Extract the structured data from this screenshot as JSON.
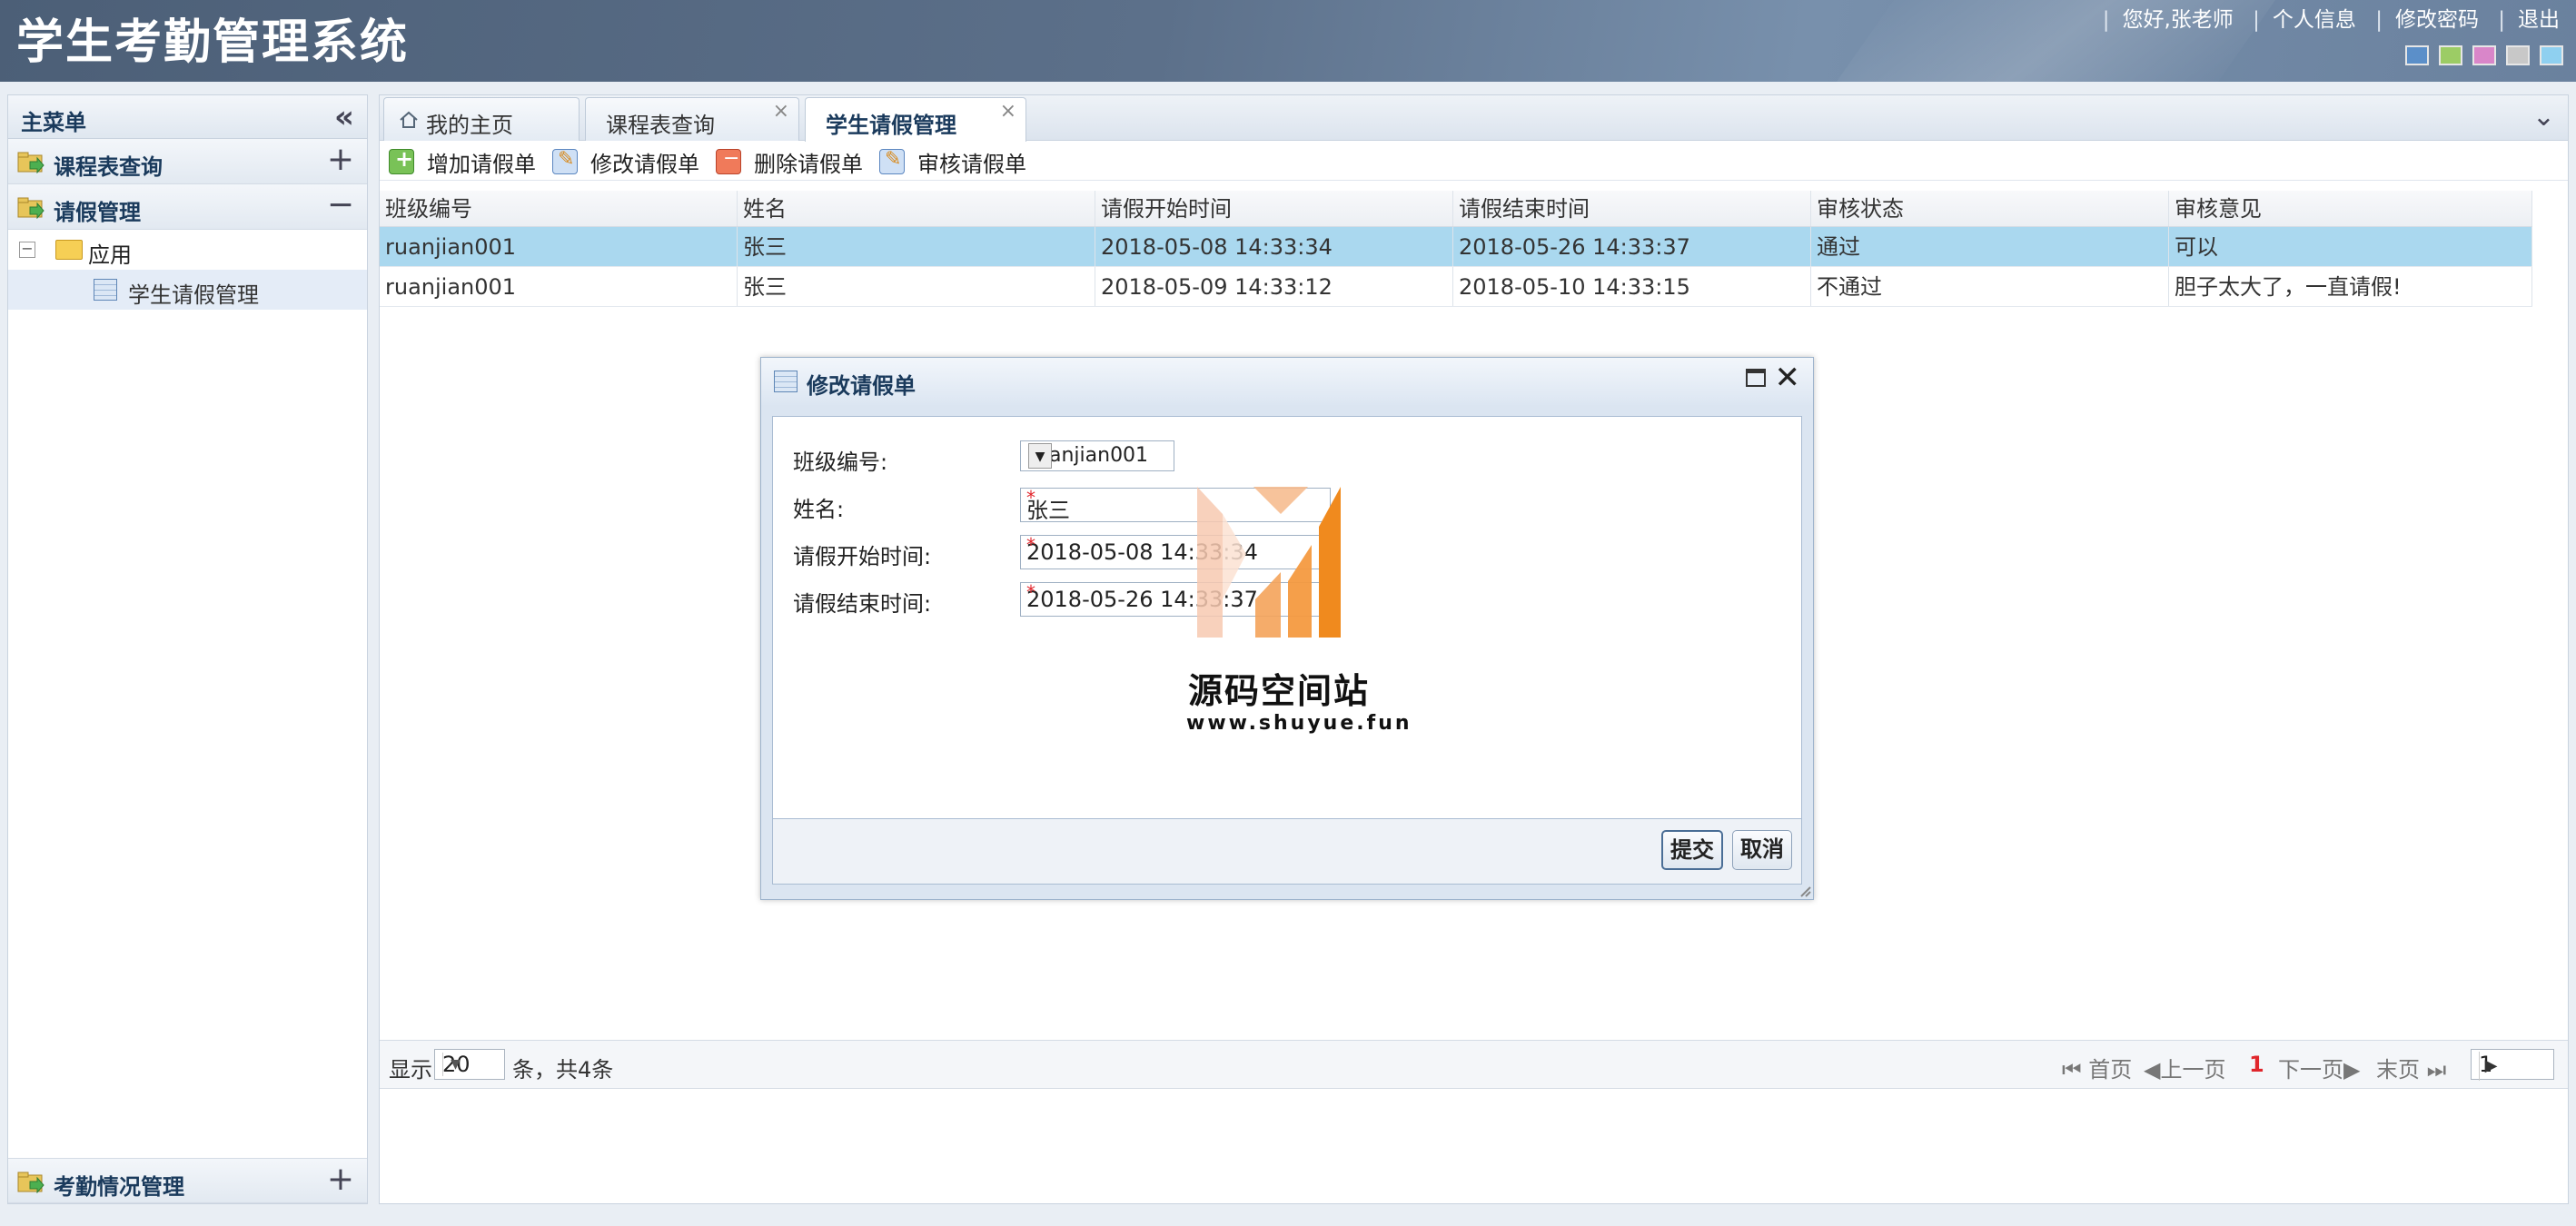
{
  "header": {
    "app_title": "学生考勤管理系统",
    "links": [
      "您好,张老师",
      "个人信息",
      "修改密码",
      "退出"
    ],
    "theme_colors": [
      "#5b8fc9",
      "#9ccc65",
      "#d986c9",
      "#c8c8c8",
      "#8fd0f0"
    ]
  },
  "sidebar": {
    "title": "主菜单",
    "sections": [
      {
        "label": "课程表查询",
        "toggle": "+"
      },
      {
        "label": "请假管理",
        "toggle": "−"
      }
    ],
    "tree": {
      "folder": "应用",
      "item": "学生请假管理"
    },
    "bottom_section": {
      "label": "考勤情况管理",
      "toggle": "+"
    }
  },
  "tabs": [
    "我的主页",
    "课程表查询",
    "学生请假管理"
  ],
  "toolbar": [
    "增加请假单",
    "修改请假单",
    "删除请假单",
    "审核请假单"
  ],
  "grid": {
    "columns": [
      "班级编号",
      "姓名",
      "请假开始时间",
      "请假结束时间",
      "审核状态",
      "审核意见"
    ],
    "rows": [
      [
        "ruanjian001",
        "张三",
        "2018-05-08 14:33:34",
        "2018-05-26 14:33:37",
        "通过",
        "可以"
      ],
      [
        "ruanjian001",
        "张三",
        "2018-05-09 14:33:12",
        "2018-05-10 14:33:15",
        "不通过",
        "胆子太大了，一直请假!"
      ]
    ],
    "selected_row": 0
  },
  "pager": {
    "show_label": "显示",
    "page_size": "20",
    "count_text": "条，共4条",
    "first": "首页",
    "prev": "上一页",
    "current": "1",
    "next": "下一页",
    "last": "末页",
    "page_input": "1"
  },
  "dialog": {
    "title": "修改请假单",
    "fields": [
      {
        "label": "班级编号:",
        "value": "ruanjian001"
      },
      {
        "label": "姓名:",
        "value": "张三"
      },
      {
        "label": "请假开始时间:",
        "value": "2018-05-08 14:33:34"
      },
      {
        "label": "请假结束时间:",
        "value": "2018-05-26 14:33:37"
      }
    ],
    "submit": "提交",
    "cancel": "取消"
  },
  "watermark": {
    "name": "源码空间站",
    "url": "www.shuyue.fun"
  }
}
